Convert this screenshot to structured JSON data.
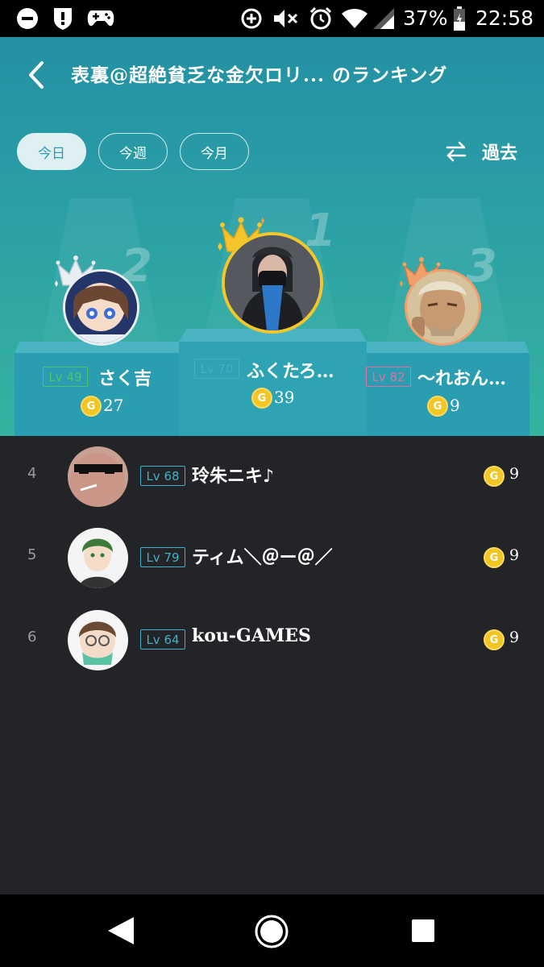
{
  "status_bar": {
    "battery": "37%",
    "time": "22:58",
    "icons": [
      "dnd-icon",
      "alert-shield-icon",
      "gamepad-icon",
      "data-saver-icon",
      "mute-icon",
      "alarm-icon",
      "wifi-icon",
      "signal-icon",
      "battery-icon"
    ]
  },
  "header": {
    "title": "表裏@超絶貧乏な金欠ロリ... のランキング",
    "back_icon": "back-icon",
    "tabs": [
      {
        "label": "今日",
        "active": true
      },
      {
        "label": "今週",
        "active": false
      },
      {
        "label": "今月",
        "active": false
      }
    ],
    "past_label": "過去",
    "past_icon": "swap-icon"
  },
  "podium": [
    {
      "rank": "2",
      "level": "Lv 49",
      "name": "さく吉",
      "points": "27",
      "level_color": "#4cc56e"
    },
    {
      "rank": "1",
      "level": "Lv 70",
      "name": "ふくたろ…",
      "points": "39",
      "level_color": "#3fb0c8"
    },
    {
      "rank": "3",
      "level": "Lv 82",
      "name": "〜れおん…",
      "points": "9",
      "level_color": "#e26fa0"
    }
  ],
  "list": [
    {
      "rank": "4",
      "level": "Lv 68",
      "name": "玲朱ニキ♪",
      "points": "9"
    },
    {
      "rank": "5",
      "level": "Lv 79",
      "name": "ティム＼＠ー＠／",
      "points": "9"
    },
    {
      "rank": "6",
      "level": "Lv 64",
      "name": "kou-GAMES",
      "points": "9"
    }
  ],
  "coin_glyph": "G",
  "colors": {
    "header_top": "#2390a2",
    "header_bottom": "#35b39e",
    "list_bg": "#232427",
    "coin": "#f3c623",
    "active_tab_bg": "#dff0f2"
  },
  "nav": {
    "back": "nav-back-icon",
    "home": "nav-home-icon",
    "recents": "nav-recents-icon"
  }
}
